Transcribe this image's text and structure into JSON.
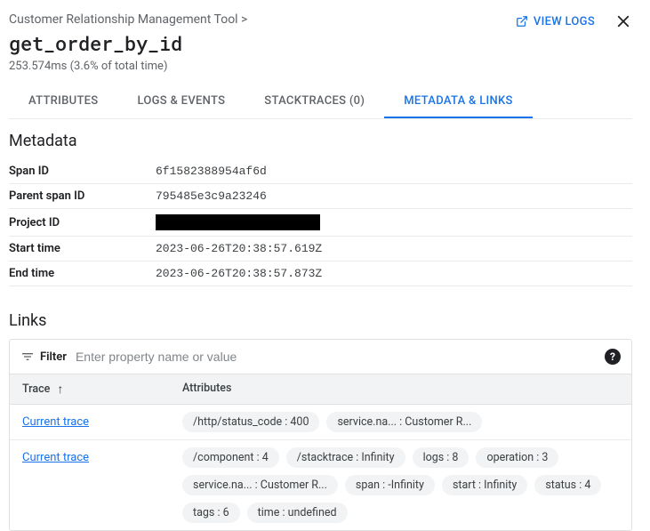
{
  "breadcrumb": "Customer Relationship Management Tool >",
  "title": "get_order_by_id",
  "subtitle": "253.574ms  (3.6% of total time)",
  "viewLogsLabel": "VIEW LOGS",
  "tabs": [
    {
      "label": "ATTRIBUTES",
      "active": false
    },
    {
      "label": "LOGS & EVENTS",
      "active": false
    },
    {
      "label": "STACKTRACES (0)",
      "active": false
    },
    {
      "label": "METADATA & LINKS",
      "active": true
    }
  ],
  "metadata": {
    "heading": "Metadata",
    "rows": [
      {
        "key": "Span ID",
        "value": "6f1582388954af6d"
      },
      {
        "key": "Parent span ID",
        "value": "795485e3c9a23246"
      },
      {
        "key": "Project ID",
        "redacted": true
      },
      {
        "key": "Start time",
        "value": "2023-06-26T20:38:57.619Z"
      },
      {
        "key": "End time",
        "value": "2023-06-26T20:38:57.873Z"
      }
    ]
  },
  "links": {
    "heading": "Links",
    "filterLabel": "Filter",
    "filterPlaceholder": "Enter property name or value",
    "columns": {
      "trace": "Trace",
      "attributes": "Attributes"
    },
    "rows": [
      {
        "traceLabel": "Current trace",
        "chips": [
          "/http/status_code : 400",
          "service.na... : Customer R..."
        ]
      },
      {
        "traceLabel": "Current trace",
        "chips": [
          "/component : 4",
          "/stacktrace : Infinity",
          "logs : 8",
          "operation : 3",
          "service.na... : Customer R...",
          "span : -Infinity",
          "start : Infinity",
          "status : 4",
          "tags : 6",
          "time : undefined"
        ]
      }
    ]
  }
}
